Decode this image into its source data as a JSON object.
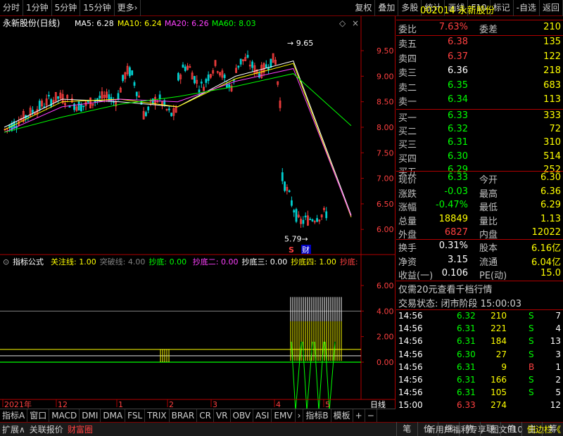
{
  "toolbar": {
    "items": [
      "分时",
      "1分钟",
      "5分钟",
      "15分钟",
      "更多›",
      "复权",
      "叠加",
      "多股",
      "统计",
      "画线",
      "F10",
      "标记",
      "-自选",
      "返回"
    ]
  },
  "chart": {
    "title": "永新股份(日线)",
    "ma_labels": [
      {
        "text": "MA5: 6.28",
        "color": "#ffffff"
      },
      {
        "text": "MA10: 6.24",
        "color": "#ffff00"
      },
      {
        "text": "MA20: 6.26",
        "color": "#ff40ff"
      },
      {
        "text": "MA60: 8.03",
        "color": "#00ff00"
      }
    ],
    "price_ticks": [
      "9.50",
      "9.00",
      "8.50",
      "8.00",
      "7.50",
      "7.00",
      "6.50",
      "6.00"
    ],
    "high_label": "9.65",
    "low_label": "5.79",
    "badge_s": "S",
    "badge_cai": "财",
    "ind_title": "指标公式",
    "ind_labels": [
      {
        "text": "关注线: 1.00",
        "color": "#ffff00"
      },
      {
        "text": "突破线: 4.00",
        "color": "#808080"
      },
      {
        "text": "抄底: 0.00",
        "color": "#00ff00"
      },
      {
        "text": "抄底二: 0.00",
        "color": "#ff40ff"
      },
      {
        "text": "抄底三: 0.00",
        "color": "#ffffff"
      },
      {
        "text": "抄底四: 1.00",
        "color": "#ffff00"
      },
      {
        "text": "抄底:",
        "color": "#ff4040"
      }
    ],
    "ind_ticks": [
      "6.00",
      "4.00",
      "2.00",
      "0.00"
    ],
    "x_labels": [
      "2021年",
      "12",
      "1",
      "2",
      "3",
      "4",
      "5"
    ],
    "x_right": "日线"
  },
  "chart_data": {
    "type": "line",
    "x": [
      "2020-11",
      "2020-12",
      "2021-01",
      "2021-02",
      "2021-03",
      "2021-04",
      "2021-05"
    ],
    "series": [
      {
        "name": "MA5",
        "values": [
          8.0,
          8.55,
          8.5,
          8.4,
          9.0,
          9.3,
          6.28
        ]
      },
      {
        "name": "MA10",
        "values": [
          7.95,
          8.5,
          8.55,
          8.4,
          8.95,
          9.25,
          6.24
        ]
      },
      {
        "name": "MA20",
        "values": [
          7.9,
          8.4,
          8.55,
          8.5,
          8.9,
          9.15,
          6.26
        ]
      },
      {
        "name": "MA60",
        "values": [
          7.9,
          8.2,
          8.45,
          8.6,
          8.8,
          9.05,
          8.03
        ]
      }
    ],
    "ylim": [
      5.7,
      9.9
    ]
  },
  "bottom_tabs": [
    "指标A",
    "窗口",
    "MACD",
    "DMI",
    "DMA",
    "FSL",
    "TRIX",
    "BRAR",
    "CR",
    "VR",
    "OBV",
    "ASI",
    "EMV",
    "›",
    "指标B",
    "模板",
    "+",
    "−"
  ],
  "status": {
    "left": [
      "扩展∧",
      "关联报价",
      "财富圈"
    ],
    "right": [
      "新用户福利专享",
      "图文F10",
      "侧边栏《"
    ]
  },
  "right_tabs": [
    "笔",
    "价",
    "细",
    "势",
    "联",
    "值",
    "主",
    "筹"
  ],
  "panel": {
    "code": "002014",
    "name": "永新股份",
    "weibi_label": "委比",
    "weibi": "7.63%",
    "weicha_label": "委差",
    "weicha": "210",
    "asks": [
      {
        "l": "卖五",
        "p": "6.38",
        "v": "135"
      },
      {
        "l": "卖四",
        "p": "6.37",
        "v": "122"
      },
      {
        "l": "卖三",
        "p": "6.36",
        "v": "218"
      },
      {
        "l": "卖二",
        "p": "6.35",
        "v": "683"
      },
      {
        "l": "卖一",
        "p": "6.34",
        "v": "113"
      }
    ],
    "bids": [
      {
        "l": "买一",
        "p": "6.33",
        "v": "333"
      },
      {
        "l": "买二",
        "p": "6.32",
        "v": "72"
      },
      {
        "l": "买三",
        "p": "6.31",
        "v": "310"
      },
      {
        "l": "买四",
        "p": "6.30",
        "v": "514"
      },
      {
        "l": "买五",
        "p": "6.29",
        "v": "252"
      }
    ],
    "quote": [
      {
        "l": "现价",
        "v": "6.33",
        "l2": "今开",
        "v2": "6.30"
      },
      {
        "l": "涨跌",
        "v": "-0.03",
        "l2": "最高",
        "v2": "6.36"
      },
      {
        "l": "涨幅",
        "v": "-0.47%",
        "l2": "最低",
        "v2": "6.29"
      },
      {
        "l": "总量",
        "v": "18849",
        "l2": "量比",
        "v2": "1.13"
      },
      {
        "l": "外盘",
        "v": "6827",
        "l2": "内盘",
        "v2": "12022"
      }
    ],
    "stats": [
      {
        "l": "换手",
        "v": "0.31%",
        "l2": "股本",
        "v2": "6.16亿"
      },
      {
        "l": "净资",
        "v": "3.15",
        "l2": "流通",
        "v2": "6.04亿"
      },
      {
        "l": "收益(一)",
        "v": "0.106",
        "l2": "PE(动)",
        "v2": "15.0"
      }
    ],
    "promo": "仅需20元查看千档行情",
    "status": "交易状态: 闭市阶段 15:00:03",
    "ticks": [
      {
        "t": "14:56",
        "p": "6.32",
        "v": "210",
        "d": "S",
        "n": "7"
      },
      {
        "t": "14:56",
        "p": "6.31",
        "v": "221",
        "d": "S",
        "n": "4"
      },
      {
        "t": "14:56",
        "p": "6.31",
        "v": "184",
        "d": "S",
        "n": "13"
      },
      {
        "t": "14:56",
        "p": "6.30",
        "v": "27",
        "d": "S",
        "n": "3"
      },
      {
        "t": "14:56",
        "p": "6.31",
        "v": "9",
        "d": "B",
        "n": "1"
      },
      {
        "t": "14:56",
        "p": "6.31",
        "v": "166",
        "d": "S",
        "n": "2"
      },
      {
        "t": "14:56",
        "p": "6.31",
        "v": "105",
        "d": "S",
        "n": "5"
      },
      {
        "t": "15:00",
        "p": "6.33",
        "v": "274",
        "d": "",
        "n": "12"
      }
    ]
  }
}
